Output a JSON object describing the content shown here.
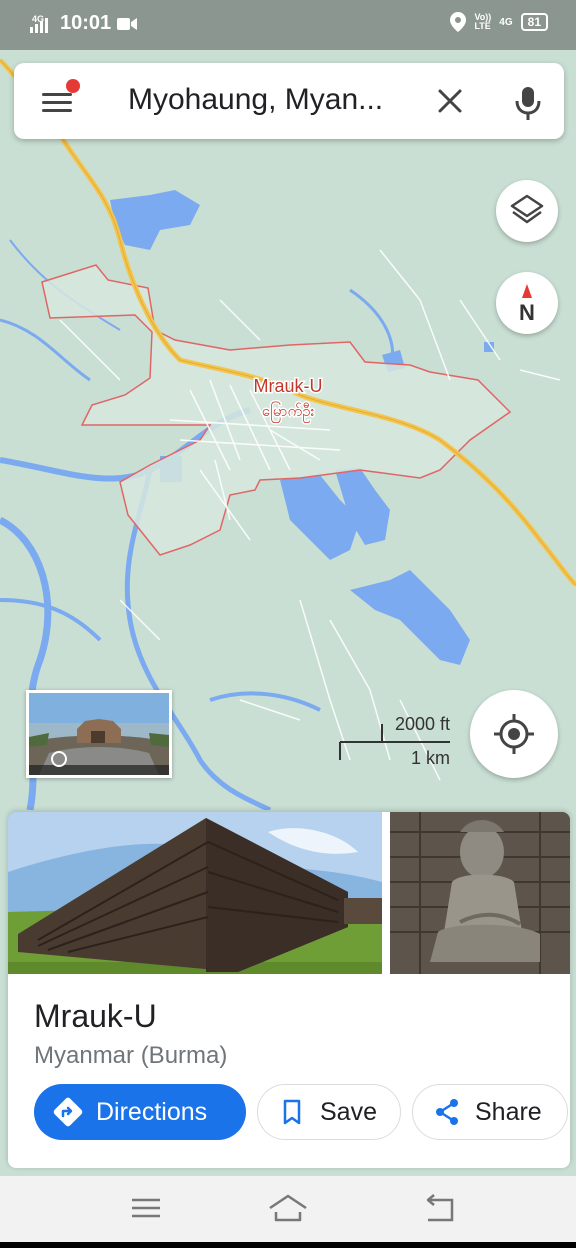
{
  "status_bar": {
    "network_left": "4G",
    "time": "10:01",
    "network_right_1": "Vo))",
    "network_right_1b": "LTE",
    "network_right_2": "4G",
    "battery": "81"
  },
  "search": {
    "query": "Myohaung, Myan..."
  },
  "map": {
    "place_label_latin": "Mrauk-U",
    "place_label_native": "မြောက်ဦး",
    "compass_label": "N",
    "scale_imperial": "2000 ft",
    "scale_metric": "1 km"
  },
  "place_card": {
    "title": "Mrauk-U",
    "subtitle": "Myanmar (Burma)",
    "directions_label": "Directions",
    "save_label": "Save",
    "share_label": "Share"
  },
  "colors": {
    "accent": "#1a73e8",
    "map_land": "#c9dfd3",
    "map_water": "#7baaf0",
    "road_major": "#f4c54e",
    "boundary": "#e06666"
  },
  "icons": [
    "menu-icon",
    "close-icon",
    "mic-icon",
    "layers-icon",
    "compass-icon",
    "my-location-icon",
    "directions-icon",
    "bookmark-icon",
    "share-icon",
    "recents-icon",
    "home-icon",
    "back-icon"
  ]
}
